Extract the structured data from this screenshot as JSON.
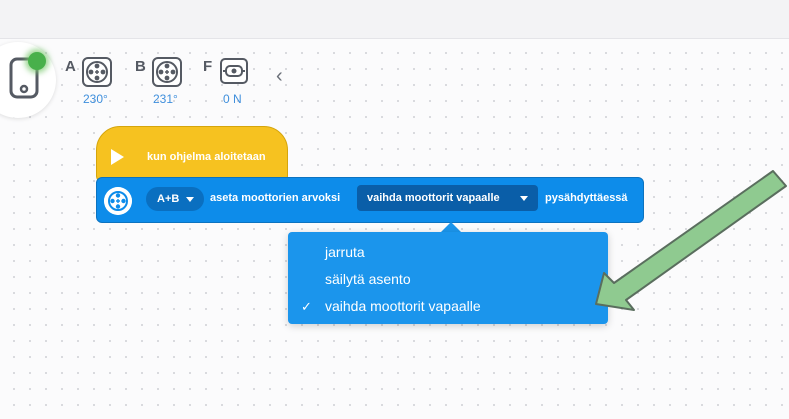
{
  "hub": {
    "status_color": "#48b04b"
  },
  "ports": [
    {
      "letter": "A",
      "value": "230°",
      "icon": "motor-icon"
    },
    {
      "letter": "B",
      "value": "231°",
      "icon": "motor-icon"
    },
    {
      "letter": "F",
      "value": "0 N",
      "icon": "force-sensor-icon"
    }
  ],
  "collapse_symbol": "‹",
  "hat_block": {
    "label": "kun ohjelma aloitetaan",
    "color": "#f6c220"
  },
  "motor_block": {
    "port_selector": "A+B",
    "text_before": "aseta moottorien arvoksi",
    "mode_selector": "vaihda moottorit vapaalle",
    "text_after": "pysähdyttäessä",
    "color": "#0d8cea"
  },
  "dropdown": {
    "options": [
      {
        "label": "jarruta",
        "selected": false
      },
      {
        "label": "säilytä asento",
        "selected": false
      },
      {
        "label": "vaihda moottorit vapaalle",
        "selected": true
      }
    ],
    "check_mark": "✓",
    "color": "#1b95ec"
  },
  "annotation_arrow": {
    "color": "#8fca90",
    "outline": "#5a6e5e"
  }
}
